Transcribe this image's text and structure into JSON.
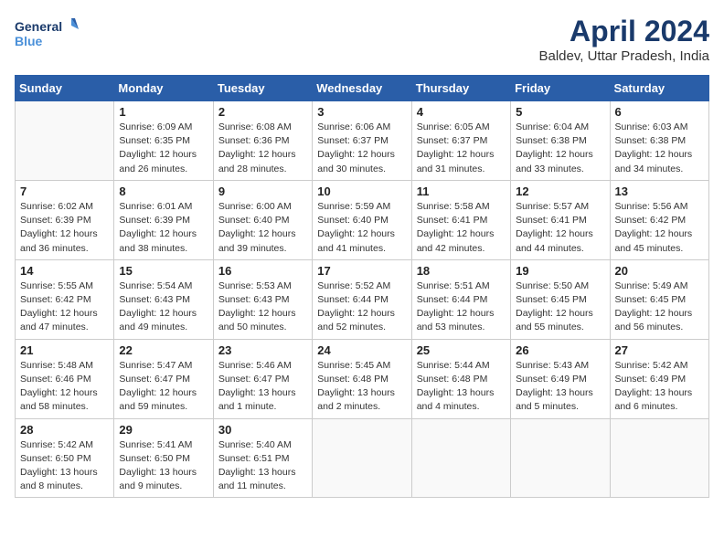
{
  "logo": {
    "line1": "General",
    "line2": "Blue"
  },
  "title": "April 2024",
  "subtitle": "Baldev, Uttar Pradesh, India",
  "weekdays": [
    "Sunday",
    "Monday",
    "Tuesday",
    "Wednesday",
    "Thursday",
    "Friday",
    "Saturday"
  ],
  "weeks": [
    [
      {
        "day": "",
        "info": ""
      },
      {
        "day": "1",
        "info": "Sunrise: 6:09 AM\nSunset: 6:35 PM\nDaylight: 12 hours\nand 26 minutes."
      },
      {
        "day": "2",
        "info": "Sunrise: 6:08 AM\nSunset: 6:36 PM\nDaylight: 12 hours\nand 28 minutes."
      },
      {
        "day": "3",
        "info": "Sunrise: 6:06 AM\nSunset: 6:37 PM\nDaylight: 12 hours\nand 30 minutes."
      },
      {
        "day": "4",
        "info": "Sunrise: 6:05 AM\nSunset: 6:37 PM\nDaylight: 12 hours\nand 31 minutes."
      },
      {
        "day": "5",
        "info": "Sunrise: 6:04 AM\nSunset: 6:38 PM\nDaylight: 12 hours\nand 33 minutes."
      },
      {
        "day": "6",
        "info": "Sunrise: 6:03 AM\nSunset: 6:38 PM\nDaylight: 12 hours\nand 34 minutes."
      }
    ],
    [
      {
        "day": "7",
        "info": "Sunrise: 6:02 AM\nSunset: 6:39 PM\nDaylight: 12 hours\nand 36 minutes."
      },
      {
        "day": "8",
        "info": "Sunrise: 6:01 AM\nSunset: 6:39 PM\nDaylight: 12 hours\nand 38 minutes."
      },
      {
        "day": "9",
        "info": "Sunrise: 6:00 AM\nSunset: 6:40 PM\nDaylight: 12 hours\nand 39 minutes."
      },
      {
        "day": "10",
        "info": "Sunrise: 5:59 AM\nSunset: 6:40 PM\nDaylight: 12 hours\nand 41 minutes."
      },
      {
        "day": "11",
        "info": "Sunrise: 5:58 AM\nSunset: 6:41 PM\nDaylight: 12 hours\nand 42 minutes."
      },
      {
        "day": "12",
        "info": "Sunrise: 5:57 AM\nSunset: 6:41 PM\nDaylight: 12 hours\nand 44 minutes."
      },
      {
        "day": "13",
        "info": "Sunrise: 5:56 AM\nSunset: 6:42 PM\nDaylight: 12 hours\nand 45 minutes."
      }
    ],
    [
      {
        "day": "14",
        "info": "Sunrise: 5:55 AM\nSunset: 6:42 PM\nDaylight: 12 hours\nand 47 minutes."
      },
      {
        "day": "15",
        "info": "Sunrise: 5:54 AM\nSunset: 6:43 PM\nDaylight: 12 hours\nand 49 minutes."
      },
      {
        "day": "16",
        "info": "Sunrise: 5:53 AM\nSunset: 6:43 PM\nDaylight: 12 hours\nand 50 minutes."
      },
      {
        "day": "17",
        "info": "Sunrise: 5:52 AM\nSunset: 6:44 PM\nDaylight: 12 hours\nand 52 minutes."
      },
      {
        "day": "18",
        "info": "Sunrise: 5:51 AM\nSunset: 6:44 PM\nDaylight: 12 hours\nand 53 minutes."
      },
      {
        "day": "19",
        "info": "Sunrise: 5:50 AM\nSunset: 6:45 PM\nDaylight: 12 hours\nand 55 minutes."
      },
      {
        "day": "20",
        "info": "Sunrise: 5:49 AM\nSunset: 6:45 PM\nDaylight: 12 hours\nand 56 minutes."
      }
    ],
    [
      {
        "day": "21",
        "info": "Sunrise: 5:48 AM\nSunset: 6:46 PM\nDaylight: 12 hours\nand 58 minutes."
      },
      {
        "day": "22",
        "info": "Sunrise: 5:47 AM\nSunset: 6:47 PM\nDaylight: 12 hours\nand 59 minutes."
      },
      {
        "day": "23",
        "info": "Sunrise: 5:46 AM\nSunset: 6:47 PM\nDaylight: 13 hours\nand 1 minute."
      },
      {
        "day": "24",
        "info": "Sunrise: 5:45 AM\nSunset: 6:48 PM\nDaylight: 13 hours\nand 2 minutes."
      },
      {
        "day": "25",
        "info": "Sunrise: 5:44 AM\nSunset: 6:48 PM\nDaylight: 13 hours\nand 4 minutes."
      },
      {
        "day": "26",
        "info": "Sunrise: 5:43 AM\nSunset: 6:49 PM\nDaylight: 13 hours\nand 5 minutes."
      },
      {
        "day": "27",
        "info": "Sunrise: 5:42 AM\nSunset: 6:49 PM\nDaylight: 13 hours\nand 6 minutes."
      }
    ],
    [
      {
        "day": "28",
        "info": "Sunrise: 5:42 AM\nSunset: 6:50 PM\nDaylight: 13 hours\nand 8 minutes."
      },
      {
        "day": "29",
        "info": "Sunrise: 5:41 AM\nSunset: 6:50 PM\nDaylight: 13 hours\nand 9 minutes."
      },
      {
        "day": "30",
        "info": "Sunrise: 5:40 AM\nSunset: 6:51 PM\nDaylight: 13 hours\nand 11 minutes."
      },
      {
        "day": "",
        "info": ""
      },
      {
        "day": "",
        "info": ""
      },
      {
        "day": "",
        "info": ""
      },
      {
        "day": "",
        "info": ""
      }
    ]
  ]
}
